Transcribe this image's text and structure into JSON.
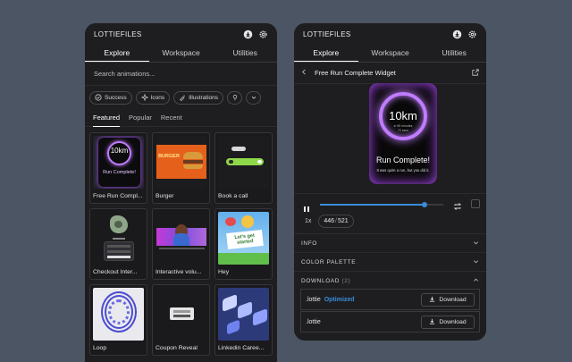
{
  "left": {
    "title": "LOTTIEFILES",
    "tabs": [
      "Explore",
      "Workspace",
      "Utilities"
    ],
    "search_placeholder": "Search animations...",
    "chips": [
      "Success",
      "Icons",
      "Illustrations"
    ],
    "subtabs": [
      "Featured",
      "Popular",
      "Recent"
    ],
    "cards": [
      {
        "label": "Free Run Compl..."
      },
      {
        "label": "Burger",
        "thumb_text": "BURGER"
      },
      {
        "label": "Book a call"
      },
      {
        "label": "Checkout Inter..."
      },
      {
        "label": "Interactive volu..."
      },
      {
        "label": "Hey",
        "thumb_text": "Let's get started"
      },
      {
        "label": "Loop"
      },
      {
        "label": "Coupon Reveal"
      },
      {
        "label": "Linkedin Caree..."
      }
    ],
    "thumb_widget": {
      "value": "10km",
      "caption": "Run Complete!"
    }
  },
  "right": {
    "title": "LOTTIEFILES",
    "tabs": [
      "Explore",
      "Workspace",
      "Utilities"
    ],
    "breadcrumb_title": "Free Run Complete Widget",
    "widget": {
      "value": "10km",
      "sub1": "in 55 minutes",
      "sub2": "72 secs",
      "heading": "Run Complete!",
      "message": "It was quite a run, but you did it."
    },
    "speed": "1x",
    "frame_current": "446",
    "frame_total": "521",
    "progress": 0.85,
    "sections": {
      "info": "INFO",
      "palette": "COLOR PALETTE",
      "download": "DOWNLOAD",
      "download_count": "(2)"
    },
    "files": [
      {
        "name": ".lottie",
        "badge": "Optimized",
        "button": "Download"
      },
      {
        "name": ".lottie",
        "badge": "",
        "button": "Download"
      }
    ]
  },
  "colors": {
    "background": "#4c5563",
    "panel": "#1e1e20",
    "accent": "#3b8bd9",
    "purple": "#c07cff"
  }
}
